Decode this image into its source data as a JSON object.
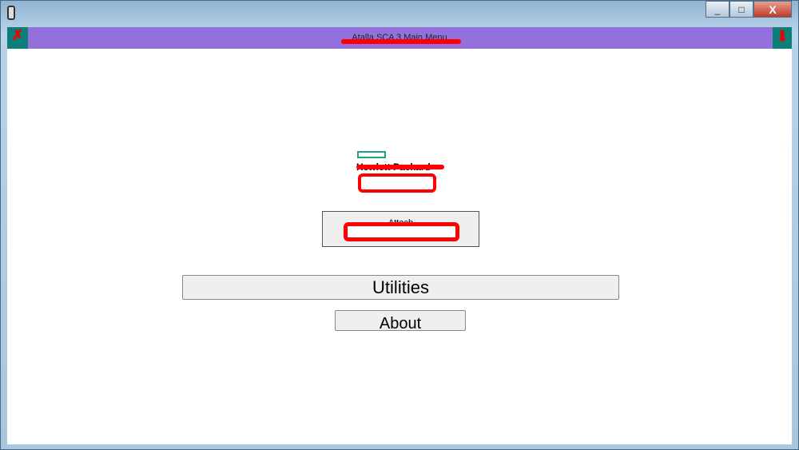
{
  "window": {
    "minimize": "_",
    "maximize": "□",
    "close": "X"
  },
  "header": {
    "title": "Atalla SCA 3 Main Menu",
    "exit_icon": "exit-icon",
    "down_icon": "arrow-down-icon",
    "colors": {
      "bar": "#9370db",
      "icon_bg": "#0a7f7a"
    }
  },
  "main": {
    "company": "Hewlett Packard",
    "attach_label": "Attach",
    "utilities_label": "Utilities",
    "about_label": "About"
  }
}
